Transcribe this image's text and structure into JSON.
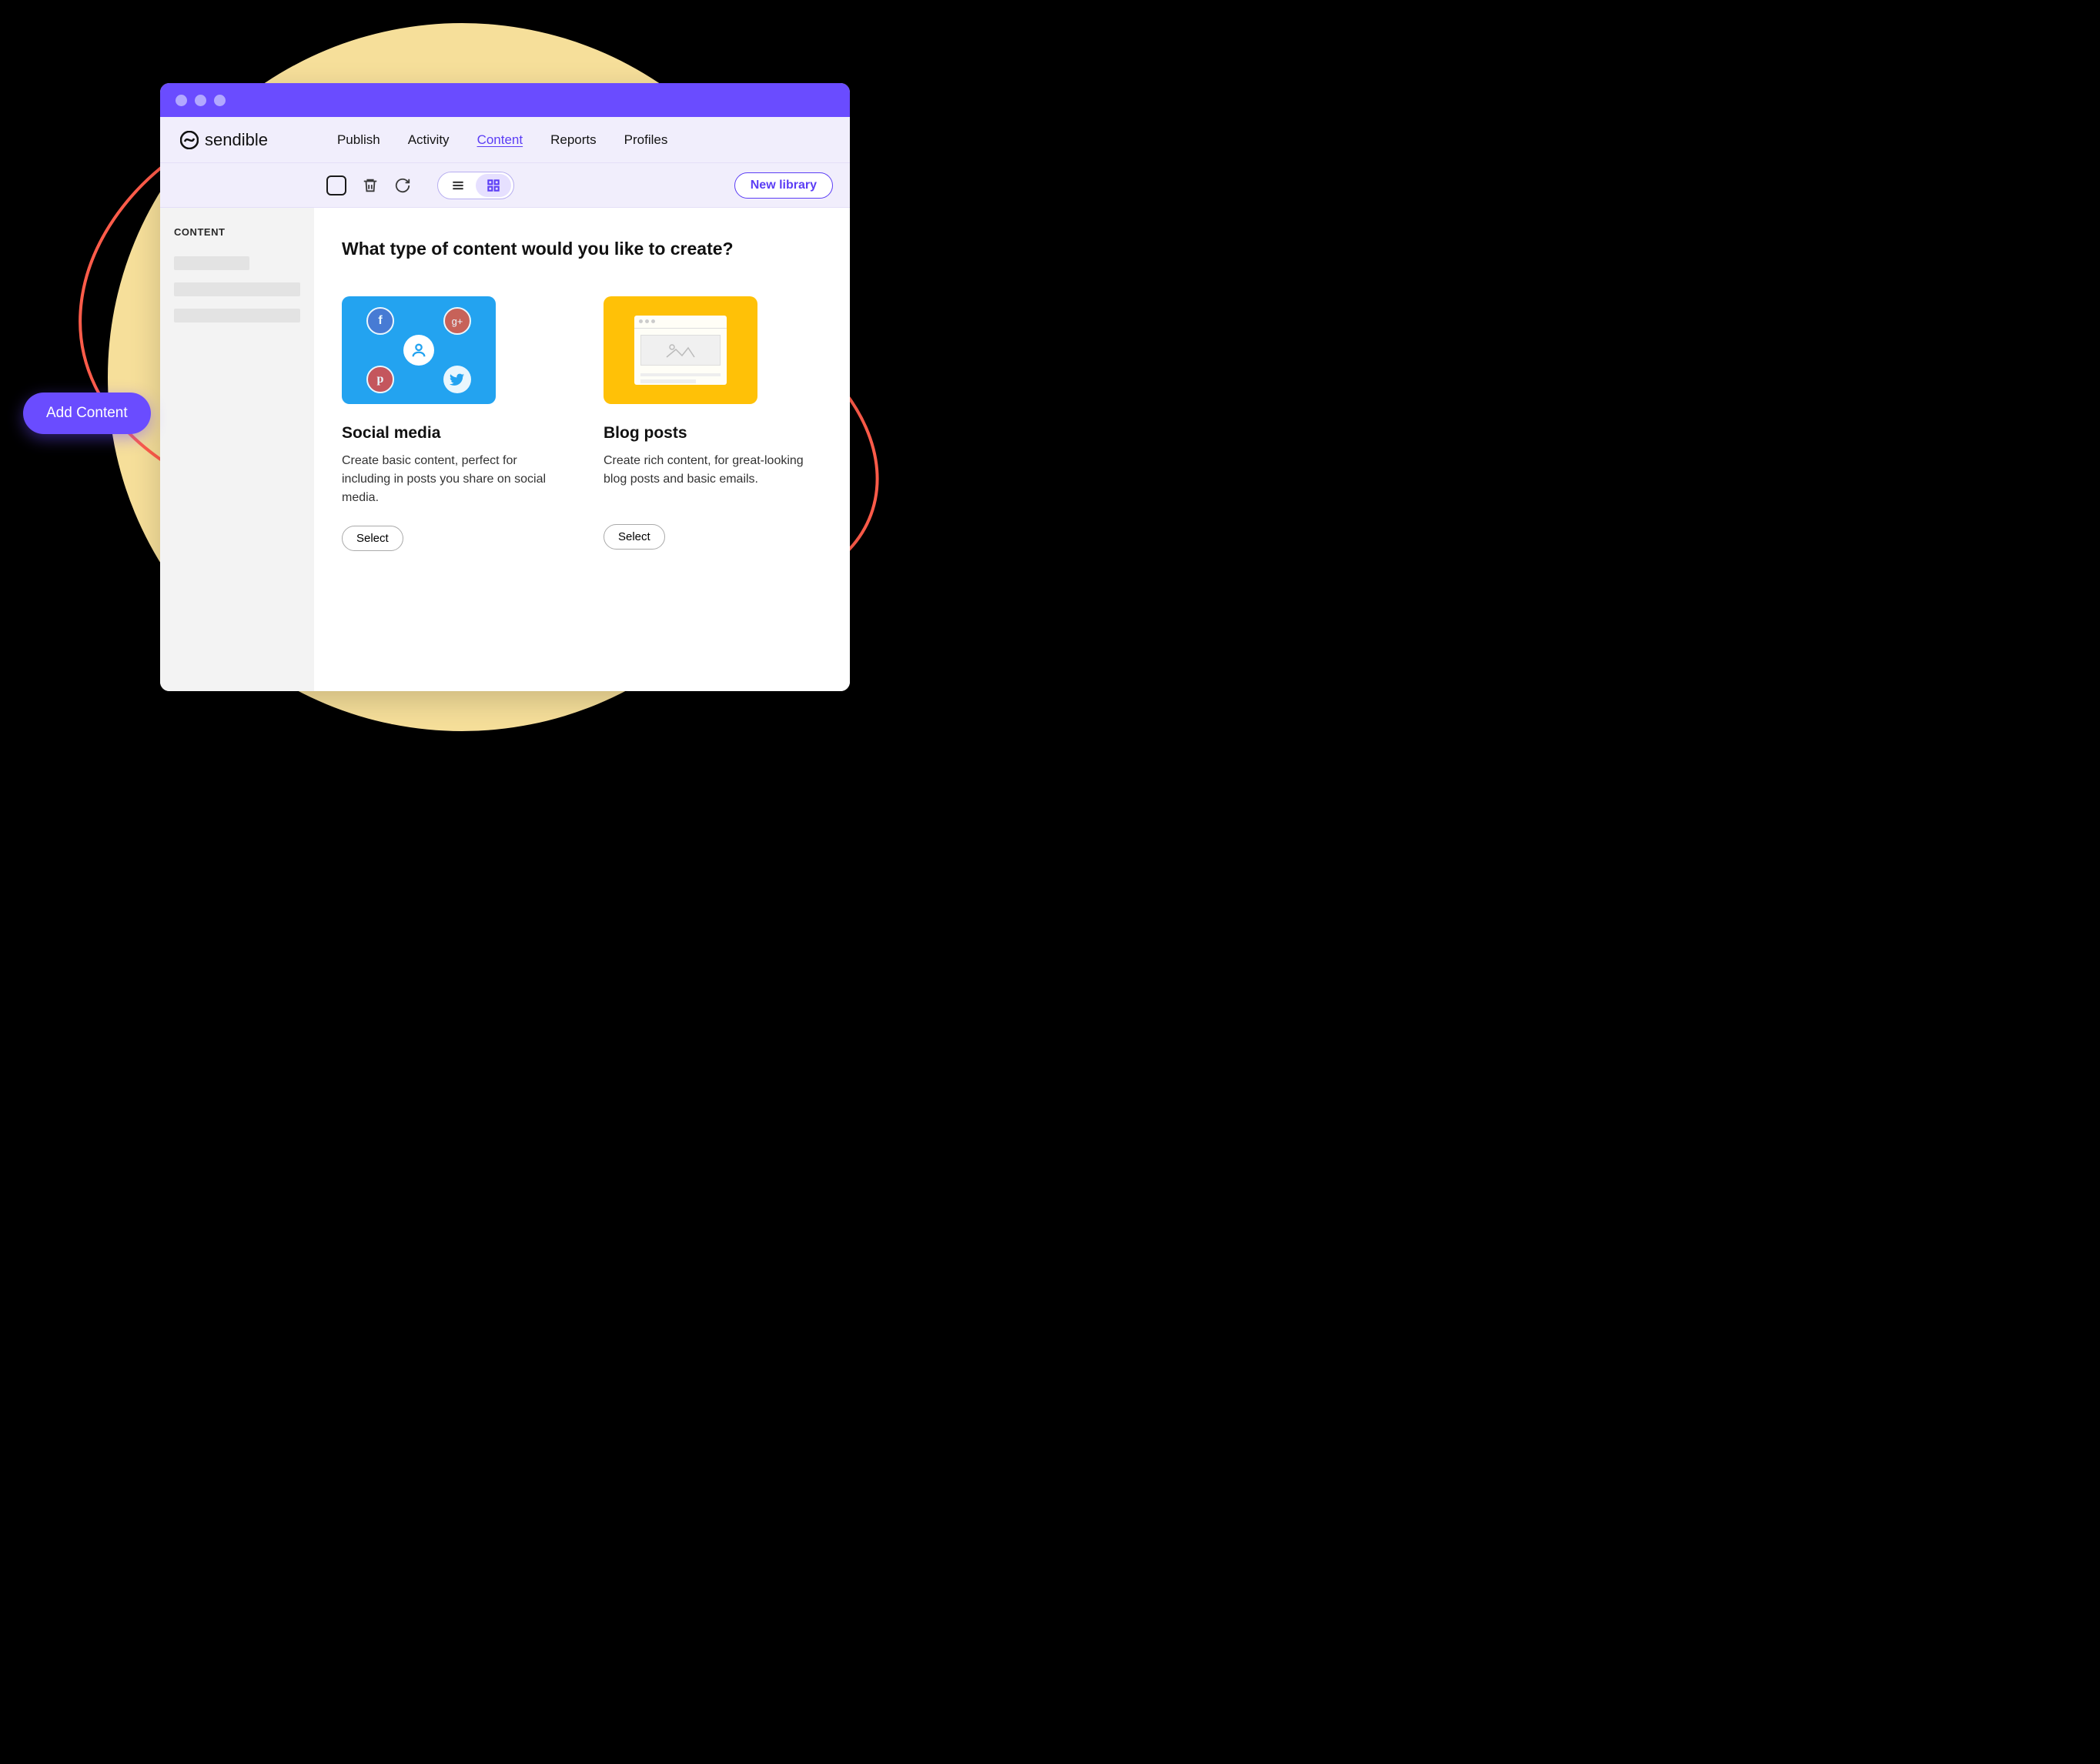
{
  "brand": "sendible",
  "nav": [
    "Publish",
    "Activity",
    "Content",
    "Reports",
    "Profiles"
  ],
  "nav_active_index": 2,
  "sidebar": {
    "title": "CONTENT"
  },
  "toolbar": {
    "new_library_label": "New library"
  },
  "main": {
    "heading": "What type of content would you like to create?",
    "cards": [
      {
        "title": "Social media",
        "desc": "Create basic content, perfect for including in posts you share on social media.",
        "select_label": "Select"
      },
      {
        "title": "Blog posts",
        "desc": "Create rich content, for great-looking blog posts and basic emails.",
        "select_label": "Select"
      }
    ]
  },
  "fab": {
    "label": "Add Content"
  }
}
